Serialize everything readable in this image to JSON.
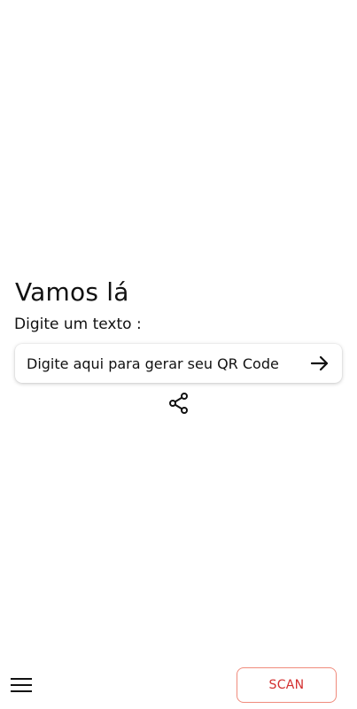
{
  "main": {
    "title": "Vamos lá",
    "input_label": "Digite um texto :",
    "input_placeholder": "Digite aqui para gerar seu QR Code",
    "input_value": ""
  },
  "icons": {
    "submit": "arrow-right-icon",
    "share": "share-icon",
    "menu": "hamburger-menu-icon"
  },
  "bottom_bar": {
    "scan_label": "SCAN"
  },
  "colors": {
    "accent": "#d32f2f",
    "scan_border": "#f08b7c",
    "text": "#111111",
    "background": "#ffffff"
  }
}
